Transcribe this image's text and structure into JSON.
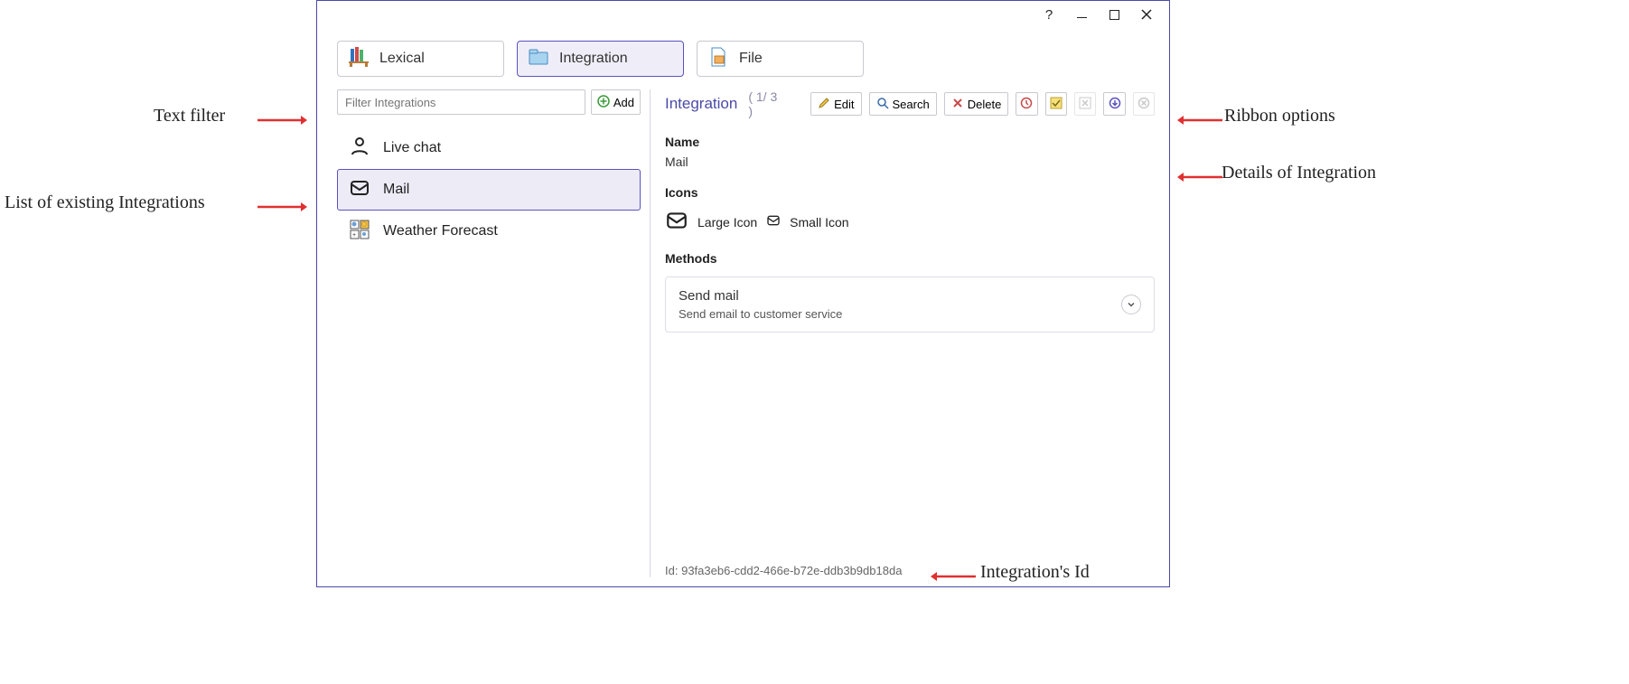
{
  "titlebar": {
    "help": "?",
    "min": "",
    "max": "",
    "close": ""
  },
  "tabs": {
    "lexical": "Lexical",
    "integration": "Integration",
    "file": "File"
  },
  "filter": {
    "placeholder": "Filter Integrations",
    "add": "Add"
  },
  "list": {
    "items": [
      {
        "label": "Live chat"
      },
      {
        "label": "Mail"
      },
      {
        "label": "Weather Forecast"
      }
    ]
  },
  "ribbon": {
    "title": "Integration",
    "count": "( 1/ 3 )",
    "edit": "Edit",
    "search": "Search",
    "delete": "Delete"
  },
  "details": {
    "name_label": "Name",
    "name_value": "Mail",
    "icons_label": "Icons",
    "large_icon_label": "Large Icon",
    "small_icon_label": "Small Icon",
    "methods_label": "Methods",
    "method_title": "Send mail",
    "method_desc": "Send email to customer service",
    "id_label": "Id:",
    "id_value": "93fa3eb6-cdd2-466e-b72e-ddb3b9db18da"
  },
  "annotations": {
    "text_filter": "Text filter",
    "list_existing": "List of existing Integrations",
    "ribbon_options": "Ribbon options",
    "details_of": "Details of Integration",
    "integration_id": "Integration's Id"
  }
}
